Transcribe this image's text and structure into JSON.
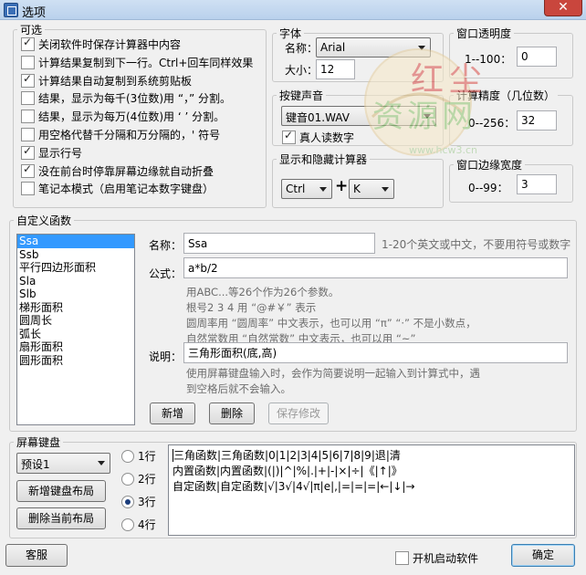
{
  "window": {
    "title": "选项",
    "close": "✕"
  },
  "optional": {
    "legend": "可选",
    "items": [
      {
        "label": "关闭软件时保存计算器中内容",
        "checked": true
      },
      {
        "label": "计算结果复制到下一行。Ctrl+回车同样效果",
        "checked": false
      },
      {
        "label": "计算结果自动复制到系统剪贴板",
        "checked": true
      },
      {
        "label": "结果，显示为每千(3位数)用 “，” 分割。",
        "checked": false
      },
      {
        "label": "结果，显示为每万(4位数)用 ‘ ’ 分割。",
        "checked": false
      },
      {
        "label": "用空格代替千分隔和万分隔的，' 符号",
        "checked": false
      },
      {
        "label": "显示行号",
        "checked": true
      },
      {
        "label": "没在前台时停靠屏幕边缘就自动折叠",
        "checked": true
      },
      {
        "label": "笔记本模式（启用笔记本数字键盘）",
        "checked": false
      }
    ]
  },
  "font": {
    "legend": "字体",
    "name_label": "名称：",
    "name_value": "Arial",
    "size_label": "大小：",
    "size_value": "12"
  },
  "sound": {
    "legend": "按键声音",
    "value": "键音01.WAV",
    "voice_label": "真人读数字",
    "voice_checked": true
  },
  "hotkey": {
    "legend": "显示和隐藏计算器",
    "mod": "Ctrl",
    "plus": "+",
    "key": "K"
  },
  "opacity": {
    "legend": "窗口透明度",
    "range": "1--100：",
    "value": "0"
  },
  "precision": {
    "legend": "计算精度（几位数）",
    "range": "0--256：",
    "value": "32"
  },
  "edge": {
    "legend": "窗口边缘宽度",
    "range": "0--99：",
    "value": "3"
  },
  "custom": {
    "legend": "自定义函数",
    "functions": [
      "Ssa",
      "Ssb",
      "平行四边形面积",
      "Sla",
      "Slb",
      "梯形面积",
      "圆周长",
      "弧长",
      "扇形面积",
      "圆形面积"
    ],
    "name_label": "名称：",
    "name_value": "Ssa",
    "name_hint": "1-20个英文或中文，不要用符号或数字",
    "formula_label": "公式：",
    "formula_value": "a*b/2",
    "help_lines": [
      "用ABC...等26个作为26个参数。",
      "根号2 3 4 用 “@#￥” 表示",
      "圆周率用 “圆周率” 中文表示，也可以用 “π” “·” 不是小数点，",
      "自然常数用 “自然常数” 中文表示，也可以用 “~”"
    ],
    "desc_label": "说明：",
    "desc_value": "三角形面积(底,高)",
    "desc_help_1": "使用屏幕键盘输入时，会作为简要说明一起输入到计算式中，遇",
    "desc_help_2": "到空格后就不会输入。",
    "btn_add": "新增",
    "btn_delete": "删除",
    "btn_save": "保存修改"
  },
  "keyboard": {
    "legend": "屏幕键盘",
    "preset": "预设1",
    "btn_new": "新增键盘布局",
    "btn_delete": "删除当前布局",
    "rows": [
      {
        "label": "1行",
        "checked": false
      },
      {
        "label": "2行",
        "checked": false
      },
      {
        "label": "3行",
        "checked": true
      },
      {
        "label": "4行",
        "checked": false
      }
    ],
    "lines": [
      "三角函数|三角函数|0|1|2|3|4|5|6|7|8|9|退|清",
      "内置函数|内置函数|(|)|^|%|.|+|-|×|÷|《|↑|》",
      "自定函数|自定函数|√|3√|4√|π|e|,|=|=|=|←|↓|→"
    ]
  },
  "footer": {
    "service": "客服",
    "autostart": "开机启动软件",
    "autostart_checked": false,
    "ok": "确定"
  },
  "watermark": {
    "line1": "红尘",
    "line2": "资源网",
    "url": "www.hcw3.cn"
  }
}
